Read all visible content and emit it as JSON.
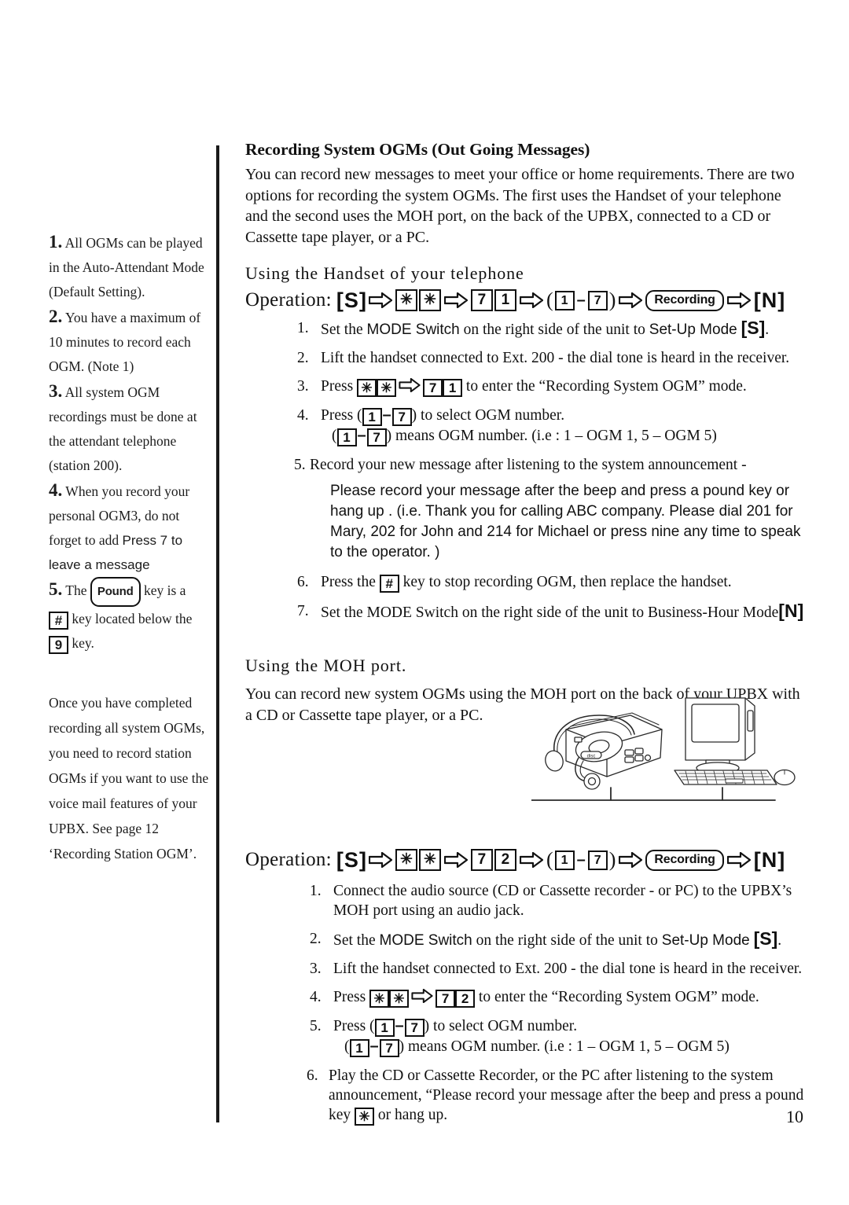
{
  "page": {
    "number": "10"
  },
  "margin_notes": {
    "group_a": [
      {
        "num": "1.",
        "text": " All OGMs can be played in the Auto-Attendant Mode (Default Setting)."
      },
      {
        "num": "2.",
        "text": " You have a maximum of 10 minutes to record each OGM. (Note 1)"
      },
      {
        "num": "3.",
        "text": " All system OGM recordings must be done at the attendant telephone (station 200)."
      },
      {
        "num": "4.",
        "text": " When you record your personal OGM3, do not forget to add ",
        "emphasis": "Press 7 to leave a message"
      },
      {
        "num": "5.",
        "text_before": " The ",
        "pill": "Pound",
        "text_mid": " key is a ",
        "key1": "#",
        "text_mid2": " key located below the ",
        "key2": "9",
        "text_after": " key."
      }
    ],
    "group_b": "Once you have completed recording all system OGMs, you need to record station OGMs if you want to use the voice mail features of your UPBX.  See page 12 ‘Recording Station OGM’."
  },
  "main": {
    "heading": "Recording System OGMs (Out Going Messages)",
    "intro": "You can record new messages to meet your office or home requirements. There are two options for recording the system OGMs.  The first uses the Handset of your telephone and the second uses the MOH port, on the back of the UPBX, connected to a CD or Cassette tape player, or a PC.",
    "section1": {
      "subheading": "Using the Handset of your telephone",
      "operation": {
        "label": "Operation:",
        "mode_start": "S",
        "star": "✳",
        "code_digit1": "7",
        "code_digit2": "1",
        "range_low": "1",
        "range_high": "7",
        "recording_pill": "Recording",
        "mode_end": "N"
      },
      "steps": [
        {
          "n": "1.",
          "p1": "Set the ",
          "b1": "MODE Switch",
          "p2": " on the right side of the unit to ",
          "b2": "Set-Up Mode",
          "key": "S",
          "p3": "."
        },
        {
          "n": "2.",
          "p1": "Lift the handset connected to Ext. 200 - the dial tone is heard in the receiver."
        },
        {
          "n": "3.",
          "p1": "Press ",
          "k1": "✳",
          "k2": "✳",
          "k3": "7",
          "k4": "1",
          "p2": " to enter the “Recording System OGM” mode."
        },
        {
          "n": "4.",
          "p1": "Press (",
          "k1": "1",
          "k2": "7",
          "p2": ") to select OGM number.",
          "p3": "(",
          "k3": "1",
          "k4": "7",
          "p4": ") means OGM number.  (i.e : 1 – OGM 1,  5 – OGM 5)"
        },
        {
          "n": "5.",
          "p1": "Record your new message after listening to the system announcement -"
        },
        {
          "n": "6.",
          "p1": "Press the ",
          "k1": "#",
          "p2": " key to stop recording OGM, then replace the handset."
        },
        {
          "n": "7.",
          "p1": "Set the ",
          "b1": "MODE Switch",
          "p2": " on the right side of the unit to Business-Hour Mode",
          "key": "N"
        }
      ],
      "announcement": "Please record your message after the beep and press a pound key or hang up .  (i.e. Thank you for calling ABC company.  Please dial 201 for Mary, 202 for John and 214 for Michael or  press nine any time to speak to the operator. )"
    },
    "section2": {
      "subheading": "Using the MOH port.",
      "intro": "You can record new system OGMs using the MOH port on the back of your UPBX with a CD or Cassette tape player, or a PC.",
      "illustration": {
        "items": [
          "cd-player-icon",
          "desktop-pc-icon"
        ]
      },
      "operation": {
        "label": "Operation:",
        "mode_start": "S",
        "star": "✳",
        "code_digit1": "7",
        "code_digit2": "2",
        "range_low": "1",
        "range_high": "7",
        "recording_pill": "Recording",
        "mode_end": "N"
      },
      "steps": [
        {
          "n": "1.",
          "p1": "Connect the audio source (CD or Cassette recorder - or PC) to the UPBX’s MOH port using an audio jack."
        },
        {
          "n": "2.",
          "p1": "Set the ",
          "b1": "MODE Switch",
          "p2": " on the right side of the unit to ",
          "b2": "Set-Up Mode",
          "key": "S",
          "p3": "."
        },
        {
          "n": "3.",
          "p1": "Lift the handset connected to Ext. 200 - the dial tone is heard in the receiver."
        },
        {
          "n": "4.",
          "p1": "Press ",
          "k1": "✳",
          "k2": "✳",
          "k3": "7",
          "k4": "2",
          "p2": " to enter the “Recording System OGM” mode."
        },
        {
          "n": "5.",
          "p1": "Press (",
          "k1": "1",
          "k2": "7",
          "p2": ") to select OGM number.",
          "p3": "(",
          "k3": "1",
          "k4": "7",
          "p4": ") means OGM number.  (i.e : 1 – OGM 1,  5 – OGM 5)"
        },
        {
          "n": "6.",
          "p1": "Play the CD or Cassette Recorder, or the PC after listening to the system announcement, “Please record your message after the beep and press a pound key ",
          "k1": "✳",
          "p2": " or hang up."
        }
      ]
    }
  }
}
